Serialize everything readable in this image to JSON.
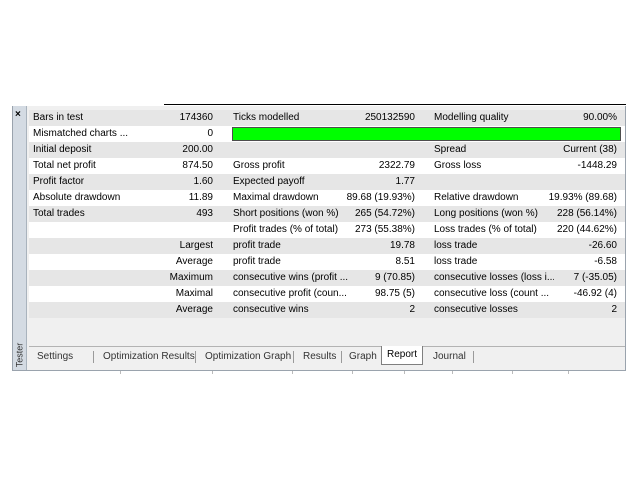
{
  "sidebar": {
    "close_glyph": "×",
    "label": "Tester"
  },
  "rows": [
    {
      "c0": "Bars in test",
      "c1": "174360",
      "c2": "Ticks modelled",
      "c3": "250132590",
      "c4": "Modelling quality",
      "c5": "90.00%"
    },
    {
      "c0": "Mismatched charts ...",
      "c1": "0",
      "c2": "",
      "c3": "",
      "c4": "",
      "c5": ""
    },
    {
      "c0": "Initial deposit",
      "c1": "200.00",
      "c2": "",
      "c3": "",
      "c4": "Spread",
      "c5": "Current (38)"
    },
    {
      "c0": "Total net profit",
      "c1": "874.50",
      "c2": "Gross profit",
      "c3": "2322.79",
      "c4": "Gross loss",
      "c5": "-1448.29"
    },
    {
      "c0": "Profit factor",
      "c1": "1.60",
      "c2": "Expected payoff",
      "c3": "1.77",
      "c4": "",
      "c5": ""
    },
    {
      "c0": "Absolute drawdown",
      "c1": "11.89",
      "c2": "Maximal drawdown",
      "c3": "89.68 (19.93%)",
      "c4": "Relative drawdown",
      "c5": "19.93% (89.68)"
    },
    {
      "c0": "Total trades",
      "c1": "493",
      "c2": "Short positions (won %)",
      "c3": "265 (54.72%)",
      "c4": "Long positions (won %)",
      "c5": "228 (56.14%)"
    },
    {
      "c0": "",
      "c1": "",
      "c2": "Profit trades (% of total)",
      "c3": "273 (55.38%)",
      "c4": "Loss trades (% of total)",
      "c5": "220 (44.62%)"
    },
    {
      "c0": "",
      "c1": "Largest",
      "c2": "profit trade",
      "c3": "19.78",
      "c4": "loss trade",
      "c5": "-26.60"
    },
    {
      "c0": "",
      "c1": "Average",
      "c2": "profit trade",
      "c3": "8.51",
      "c4": "loss trade",
      "c5": "-6.58"
    },
    {
      "c0": "",
      "c1": "Maximum",
      "c2": "consecutive wins (profit ...",
      "c3": "9 (70.85)",
      "c4": "consecutive losses (loss i...",
      "c5": "7 (-35.05)"
    },
    {
      "c0": "",
      "c1": "Maximal",
      "c2": "consecutive profit (coun...",
      "c3": "98.75 (5)",
      "c4": "consecutive loss (count ...",
      "c5": "-46.92 (4)"
    },
    {
      "c0": "",
      "c1": "Average",
      "c2": "consecutive wins",
      "c3": "2",
      "c4": "consecutive losses",
      "c5": "2"
    }
  ],
  "modelling_quality_bar": {
    "fraction": 0.9,
    "color": "#00ff00"
  },
  "tabs": [
    {
      "label": "Settings",
      "active": false
    },
    {
      "label": "Optimization Results",
      "active": false
    },
    {
      "label": "Optimization Graph",
      "active": false
    },
    {
      "label": "Results",
      "active": false
    },
    {
      "label": "Graph",
      "active": false
    },
    {
      "label": "Report",
      "active": true
    },
    {
      "label": "Journal",
      "active": false
    }
  ]
}
